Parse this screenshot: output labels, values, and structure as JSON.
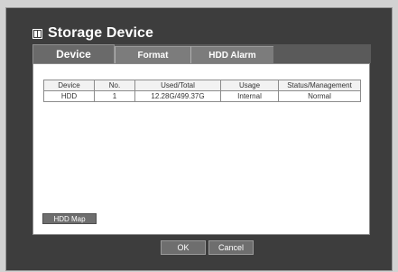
{
  "window": {
    "title": "Storage Device",
    "icon": "storage-icon"
  },
  "tabs": [
    {
      "label": "Device",
      "active": true
    },
    {
      "label": "Format",
      "active": false
    },
    {
      "label": "HDD Alarm",
      "active": false
    }
  ],
  "table": {
    "headers": [
      "Device",
      "No.",
      "Used/Total",
      "Usage",
      "Status/Management"
    ],
    "rows": [
      [
        "HDD",
        "1",
        "12.28G/499.37G",
        "Internal",
        "Normal"
      ]
    ]
  },
  "hdd_map_label": "HDD Map",
  "footer": {
    "ok_label": "OK",
    "cancel_label": "Cancel"
  }
}
